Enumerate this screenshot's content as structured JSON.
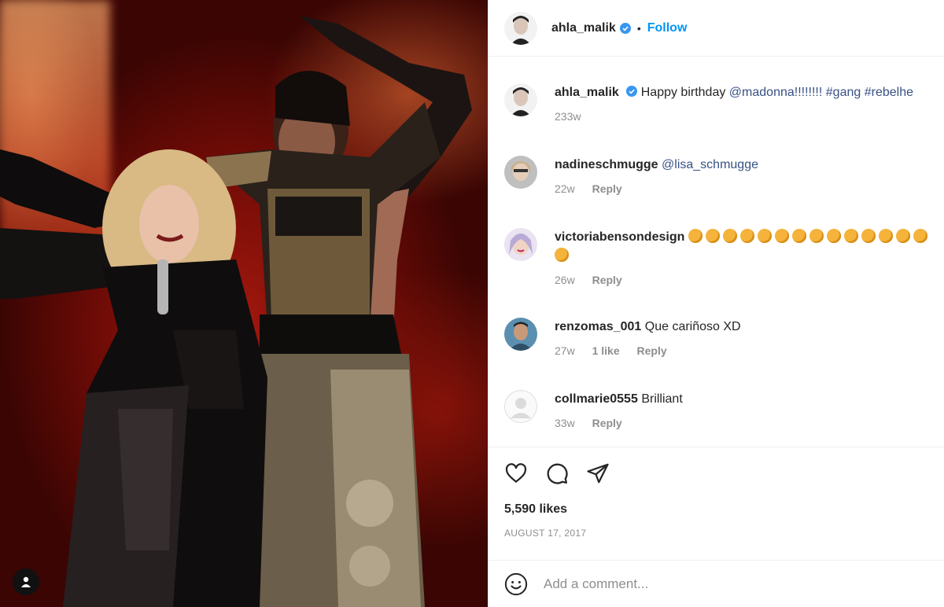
{
  "post": {
    "author": "ahla_malik",
    "follow_label": "Follow",
    "separator": "•"
  },
  "caption": {
    "username": "ahla_malik",
    "text_prefix": "Happy birthday ",
    "mention": "@madonna!!!!!!!!",
    "hashtags": "#gang #rebelhe",
    "time": "233w"
  },
  "comments": [
    {
      "username": "nadineschmugge",
      "text": "@lisa_schmugge",
      "time": "22w",
      "reply": "Reply"
    },
    {
      "username": "victoriabensondesign",
      "text": "",
      "time": "26w",
      "reply": "Reply",
      "clap_count": 15
    },
    {
      "username": "renzomas_001",
      "text": "Que cariñoso XD",
      "time": "27w",
      "likes": "1 like",
      "reply": "Reply"
    },
    {
      "username": "collmarie0555",
      "text": "Brilliant",
      "time": "33w",
      "reply": "Reply"
    }
  ],
  "stats": {
    "likes": "5,590 likes",
    "date": "AUGUST 17, 2017"
  },
  "add_comment": {
    "placeholder": "Add a comment..."
  },
  "icons": {
    "like": "heart-icon",
    "comment": "comment-icon",
    "share": "share-icon",
    "emoji": "emoji-icon",
    "verified": "verified-badge-icon",
    "user": "user-icon"
  },
  "colors": {
    "follow": "#0095f6",
    "mention": "#385185",
    "muted": "#8e8e8e",
    "verified": "#3897f0"
  }
}
